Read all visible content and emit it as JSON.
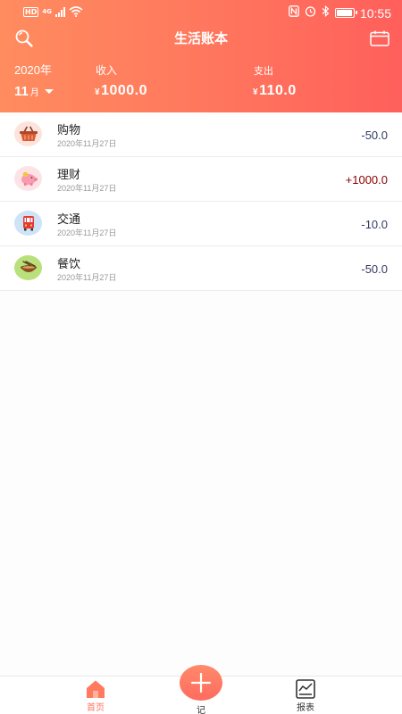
{
  "status_bar": {
    "network_type": "HD",
    "cell": "4G",
    "time": "10:55"
  },
  "header": {
    "title": "生活账本",
    "year": "2020年",
    "month": "11",
    "month_unit": "月",
    "income_label": "收入",
    "income_currency": "¥",
    "income_value": "1000.0",
    "expense_label": "支出",
    "expense_currency": "¥",
    "expense_value": "110.0"
  },
  "records": [
    {
      "category": "购物",
      "date": "2020年11月27日",
      "amount": "-50.0",
      "icon": "shopping-basket-icon"
    },
    {
      "category": "理财",
      "date": "2020年11月27日",
      "amount": "+1000.0",
      "icon": "piggy-bank-icon"
    },
    {
      "category": "交通",
      "date": "2020年11月27日",
      "amount": "-10.0",
      "icon": "bus-icon"
    },
    {
      "category": "餐饮",
      "date": "2020年11月27日",
      "amount": "-50.0",
      "icon": "food-bowl-icon"
    }
  ],
  "tabbar": {
    "home_label": "首页",
    "add_label": "记",
    "report_label": "报表"
  },
  "colors": {
    "header_start": "#ff8c5f",
    "header_end": "#ff5f5b",
    "expense_amount": "#333a66",
    "income_amount": "#8b0000",
    "active_tab": "#ff7560"
  }
}
